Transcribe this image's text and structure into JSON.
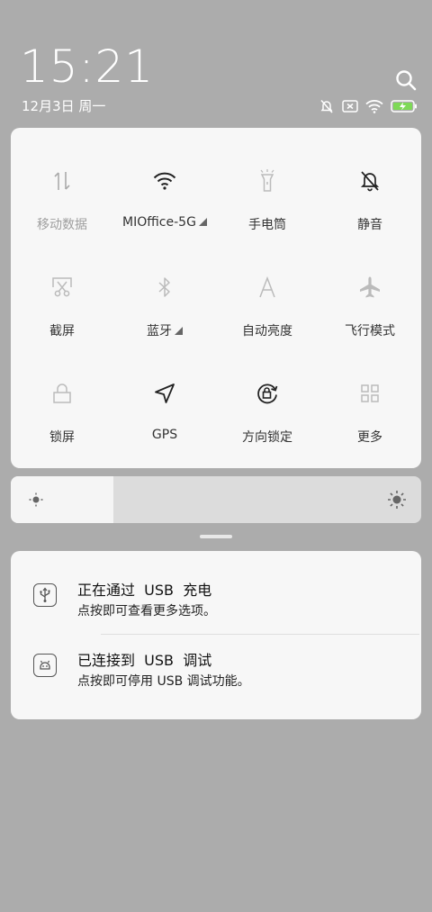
{
  "status": {
    "time": "15:21",
    "date": "12月3日 周一",
    "icons": [
      "mute-icon",
      "sim-off-icon",
      "wifi-icon",
      "battery-charging-icon"
    ]
  },
  "tiles": [
    {
      "label": "移动数据",
      "icon": "mobile-data-icon",
      "active": false
    },
    {
      "label": "MIOffice-5G",
      "icon": "wifi-icon",
      "active": true,
      "expand": true
    },
    {
      "label": "手电筒",
      "icon": "flashlight-icon",
      "active": true
    },
    {
      "label": "静音",
      "icon": "mute-icon",
      "active": true
    },
    {
      "label": "截屏",
      "icon": "screenshot-icon",
      "active": true
    },
    {
      "label": "蓝牙",
      "icon": "bluetooth-icon",
      "active": true,
      "expand": true
    },
    {
      "label": "自动亮度",
      "icon": "auto-brightness-icon",
      "active": true
    },
    {
      "label": "飞行模式",
      "icon": "airplane-icon",
      "active": true
    },
    {
      "label": "锁屏",
      "icon": "lock-icon",
      "active": true
    },
    {
      "label": "GPS",
      "icon": "gps-icon",
      "active": true
    },
    {
      "label": "方向锁定",
      "icon": "rotation-lock-icon",
      "active": true
    },
    {
      "label": "更多",
      "icon": "more-grid-icon",
      "active": true
    }
  ],
  "brightness": {
    "level": 0.25
  },
  "notifications": [
    {
      "title": "正在通过  USB  充电",
      "subtitle": "点按即可查看更多选项。",
      "icon": "usb-icon"
    },
    {
      "title": "已连接到  USB  调试",
      "subtitle": "点按即可停用 USB 调试功能。",
      "icon": "android-debug-icon"
    }
  ]
}
